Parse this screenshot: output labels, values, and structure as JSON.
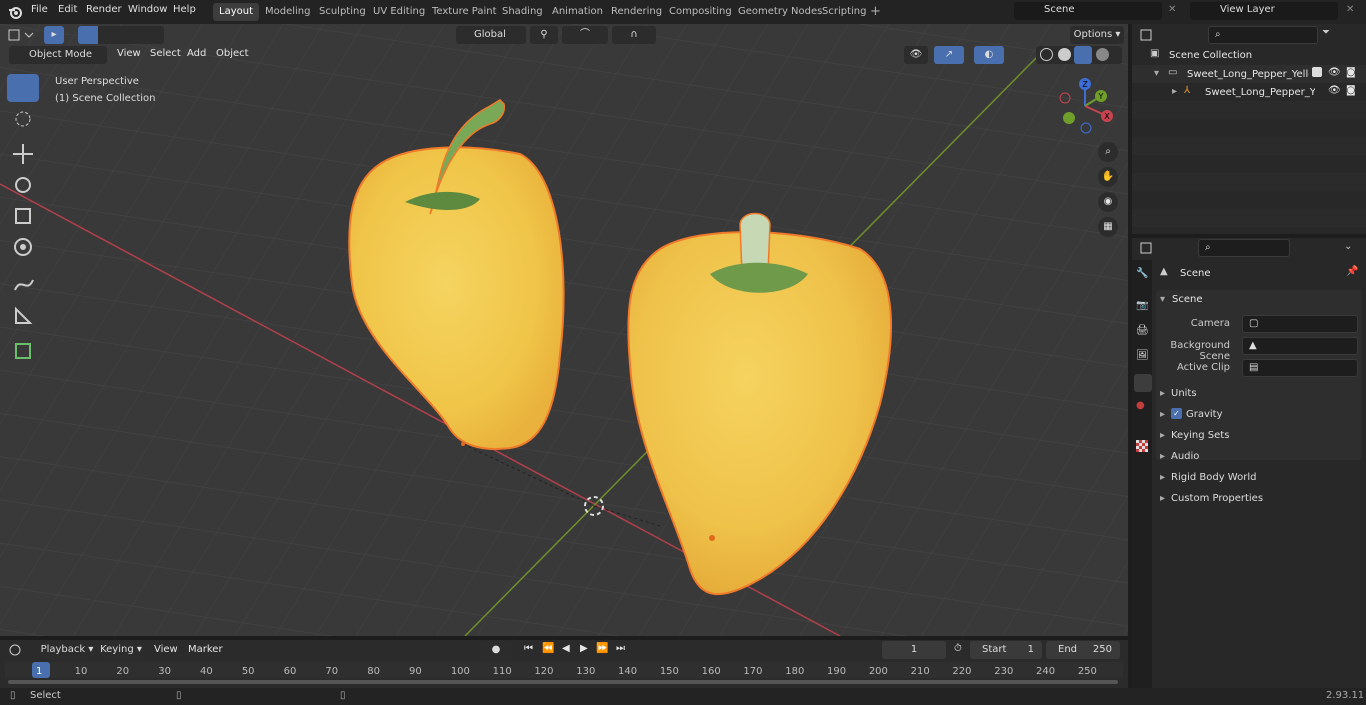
{
  "top_menu": {
    "file": "File",
    "edit": "Edit",
    "render": "Render",
    "window": "Window",
    "help": "Help"
  },
  "workspaces": [
    {
      "label": "Layout",
      "active": true
    },
    {
      "label": "Modeling"
    },
    {
      "label": "Sculpting"
    },
    {
      "label": "UV Editing"
    },
    {
      "label": "Texture Paint"
    },
    {
      "label": "Shading"
    },
    {
      "label": "Animation"
    },
    {
      "label": "Rendering"
    },
    {
      "label": "Compositing"
    },
    {
      "label": "Geometry Nodes"
    },
    {
      "label": "Scripting"
    }
  ],
  "scene_field": "Scene",
  "view_layer_field": "View Layer",
  "header": {
    "mode": "Object Mode",
    "view": "View",
    "select": "Select",
    "add": "Add",
    "object": "Object",
    "orientation": "Global",
    "options": "Options"
  },
  "viewport": {
    "perspective": "User Perspective",
    "collection": "(1) Scene Collection"
  },
  "gizmo": {
    "z": "Z",
    "y": "Y",
    "x": "X"
  },
  "outliner": {
    "root": "Scene Collection",
    "items": [
      {
        "label": "Sweet_Long_Pepper_Yellow_("
      },
      {
        "label": "Sweet_Long_Pepper_Yell"
      }
    ]
  },
  "properties": {
    "breadcrumb": "Scene",
    "panel_title": "Scene",
    "camera_label": "Camera",
    "background_label": "Background Scene",
    "clip_label": "Active Clip",
    "sections": [
      "Units",
      "Gravity",
      "Keying Sets",
      "Audio",
      "Rigid Body World",
      "Custom Properties"
    ],
    "gravity_checked": true
  },
  "timeline": {
    "playback": "Playback",
    "keying": "Keying",
    "view": "View",
    "marker": "Marker",
    "current_frame": "1",
    "start_label": "Start",
    "start_value": "1",
    "end_label": "End",
    "end_value": "250",
    "ticks": [
      "1",
      "10",
      "20",
      "30",
      "40",
      "50",
      "60",
      "70",
      "80",
      "90",
      "100",
      "110",
      "120",
      "130",
      "140",
      "150",
      "160",
      "170",
      "180",
      "190",
      "200",
      "210",
      "220",
      "230",
      "240",
      "250"
    ]
  },
  "status": {
    "select": "Select",
    "version": "2.93.11"
  },
  "colors": {
    "accent": "#4a6fae",
    "pepper": "#f2c54a",
    "outline": "#f07a2a",
    "x_axis": "#c8434f",
    "y_axis": "#7a9a2e"
  }
}
